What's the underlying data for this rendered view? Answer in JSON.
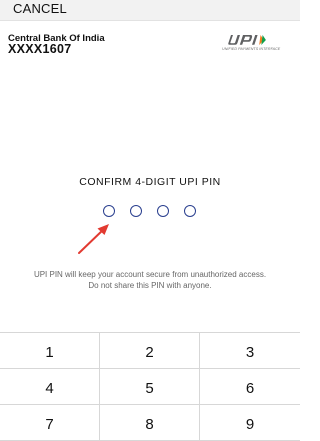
{
  "header": {
    "cancel_label": "CANCEL"
  },
  "account": {
    "bank_name": "Central Bank Of India",
    "account_number": "XXXX1607"
  },
  "logo": {
    "name": "upi-logo",
    "tagline": "UNIFIED PAYMENTS INTERFACE"
  },
  "pin": {
    "title": "CONFIRM 4-DIGIT UPI PIN",
    "digits_total": 4,
    "digits_entered": 0
  },
  "info": {
    "line1": "UPI PIN will keep your account secure from unauthorized access.",
    "line2": "Do not share this PIN with anyone."
  },
  "keypad": {
    "keys": [
      "1",
      "2",
      "3",
      "4",
      "5",
      "6",
      "7",
      "8",
      "9"
    ]
  },
  "colors": {
    "pin_circle": "#2a3f8f",
    "arrow": "#e23a31",
    "logo_gray": "#5f6062",
    "logo_orange": "#f47b20",
    "logo_green": "#12a04b"
  }
}
